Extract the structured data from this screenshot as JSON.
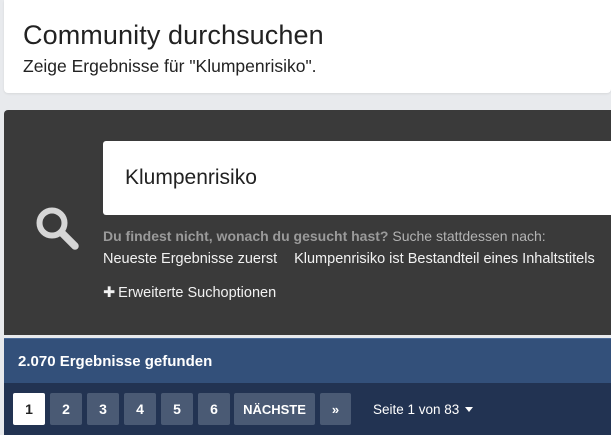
{
  "header": {
    "title": "Community durchsuchen",
    "subtitle": "Zeige Ergebnisse für \"Klumpenrisiko\"."
  },
  "search": {
    "value": "Klumpenrisiko",
    "hint_strong": "Du findest nicht, wonach du gesucht hast?",
    "hint_rest": "Suche stattdessen nach:",
    "alternatives": [
      "Neueste Ergebnisse zuerst",
      "Klumpenrisiko ist Bestandteil eines Inhaltstitels"
    ],
    "advanced_label": "Erweiterte Suchoptionen",
    "icons": {
      "search": "search-icon",
      "plus": "plus-icon"
    }
  },
  "results": {
    "count_label": "2.070 Ergebnisse gefunden"
  },
  "pagination": {
    "pages": [
      "1",
      "2",
      "3",
      "4",
      "5",
      "6"
    ],
    "current": "1",
    "next_label": "NÄCHSTE",
    "last_label": "»",
    "page_info": "Seite 1 von 83",
    "icons": {
      "dropdown": "caret-down-icon"
    }
  },
  "colors": {
    "panel_bg": "#3a3a3a",
    "results_bar_bg": "#33507a",
    "pagination_bg": "#223352",
    "page_button_bg": "#4a5a74"
  }
}
